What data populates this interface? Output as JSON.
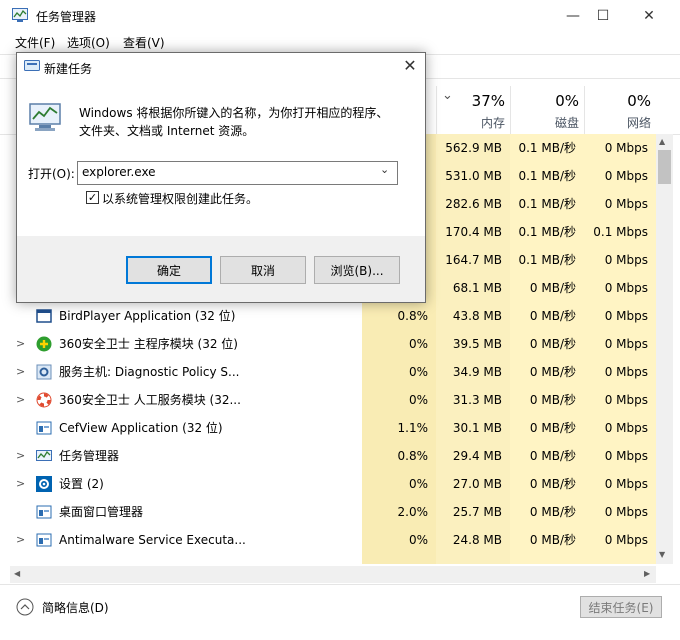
{
  "window": {
    "title": "任务管理器",
    "controls": {
      "minimize": "—",
      "maximize": "☐",
      "close": "✕"
    }
  },
  "menu": [
    "文件(F)",
    "选项(O)",
    "查看(V)"
  ],
  "columns": {
    "sort_arrow": "⌄",
    "memory": {
      "percent": "37%",
      "label": "内存"
    },
    "disk": {
      "percent": "0%",
      "label": "磁盘"
    },
    "network": {
      "percent": "0%",
      "label": "网络"
    }
  },
  "processes": [
    {
      "name": "",
      "cpu": "",
      "memory": "562.9 MB",
      "disk": "0.1 MB/秒",
      "network": "0 Mbps",
      "expandable": false
    },
    {
      "name": "",
      "cpu": "",
      "memory": "531.0 MB",
      "disk": "0.1 MB/秒",
      "network": "0 Mbps",
      "expandable": false
    },
    {
      "name": "",
      "cpu": "",
      "memory": "282.6 MB",
      "disk": "0.1 MB/秒",
      "network": "0 Mbps",
      "expandable": false
    },
    {
      "name": "",
      "cpu": "",
      "memory": "170.4 MB",
      "disk": "0.1 MB/秒",
      "network": "0.1 Mbps",
      "expandable": false
    },
    {
      "name": "",
      "cpu": "",
      "memory": "164.7 MB",
      "disk": "0.1 MB/秒",
      "network": "0 Mbps",
      "expandable": false
    },
    {
      "name": "",
      "cpu": "",
      "memory": "68.1 MB",
      "disk": "0 MB/秒",
      "network": "0 Mbps",
      "expandable": false
    },
    {
      "name": "BirdPlayer Application (32 位)",
      "cpu": "0.8%",
      "memory": "43.8 MB",
      "disk": "0 MB/秒",
      "network": "0 Mbps",
      "expandable": false,
      "icon": "window-icon"
    },
    {
      "name": "360安全卫士 主程序模块 (32 位)",
      "cpu": "0%",
      "memory": "39.5 MB",
      "disk": "0 MB/秒",
      "network": "0 Mbps",
      "expandable": true,
      "icon": "360-shield-icon"
    },
    {
      "name": "服务主机: Diagnostic Policy S...",
      "cpu": "0%",
      "memory": "34.9 MB",
      "disk": "0 MB/秒",
      "network": "0 Mbps",
      "expandable": true,
      "icon": "service-gear-icon"
    },
    {
      "name": "360安全卫士 人工服务模块 (32...",
      "cpu": "0%",
      "memory": "31.3 MB",
      "disk": "0 MB/秒",
      "network": "0 Mbps",
      "expandable": true,
      "icon": "lifebuoy-icon"
    },
    {
      "name": "CefView Application (32 位)",
      "cpu": "1.1%",
      "memory": "30.1 MB",
      "disk": "0 MB/秒",
      "network": "0 Mbps",
      "expandable": false,
      "icon": "app-window-icon"
    },
    {
      "name": "任务管理器",
      "cpu": "0.8%",
      "memory": "29.4 MB",
      "disk": "0 MB/秒",
      "network": "0 Mbps",
      "expandable": true,
      "icon": "task-manager-icon"
    },
    {
      "name": "设置 (2)",
      "cpu": "0%",
      "memory": "27.0 MB",
      "disk": "0 MB/秒",
      "network": "0 Mbps",
      "expandable": true,
      "icon": "settings-gear-icon"
    },
    {
      "name": "桌面窗口管理器",
      "cpu": "2.0%",
      "memory": "25.7 MB",
      "disk": "0 MB/秒",
      "network": "0 Mbps",
      "expandable": false,
      "icon": "app-window-icon"
    },
    {
      "name": "Antimalware Service Executa...",
      "cpu": "0%",
      "memory": "24.8 MB",
      "disk": "0 MB/秒",
      "network": "0 Mbps",
      "expandable": true,
      "icon": "app-window-icon"
    }
  ],
  "footer": {
    "less_details": "简略信息(D)",
    "end_task": "结束任务(E)"
  },
  "dialog": {
    "title": "新建任务",
    "message_line1": "Windows 将根据你所键入的名称，为你打开相应的程序、",
    "message_line2": "文件夹、文档或 Internet 资源。",
    "open_label": "打开(O):",
    "open_value": "explorer.exe",
    "admin_label": "以系统管理权限创建此任务。",
    "admin_checked": true,
    "ok": "确定",
    "cancel": "取消",
    "browse": "浏览(B)..."
  }
}
